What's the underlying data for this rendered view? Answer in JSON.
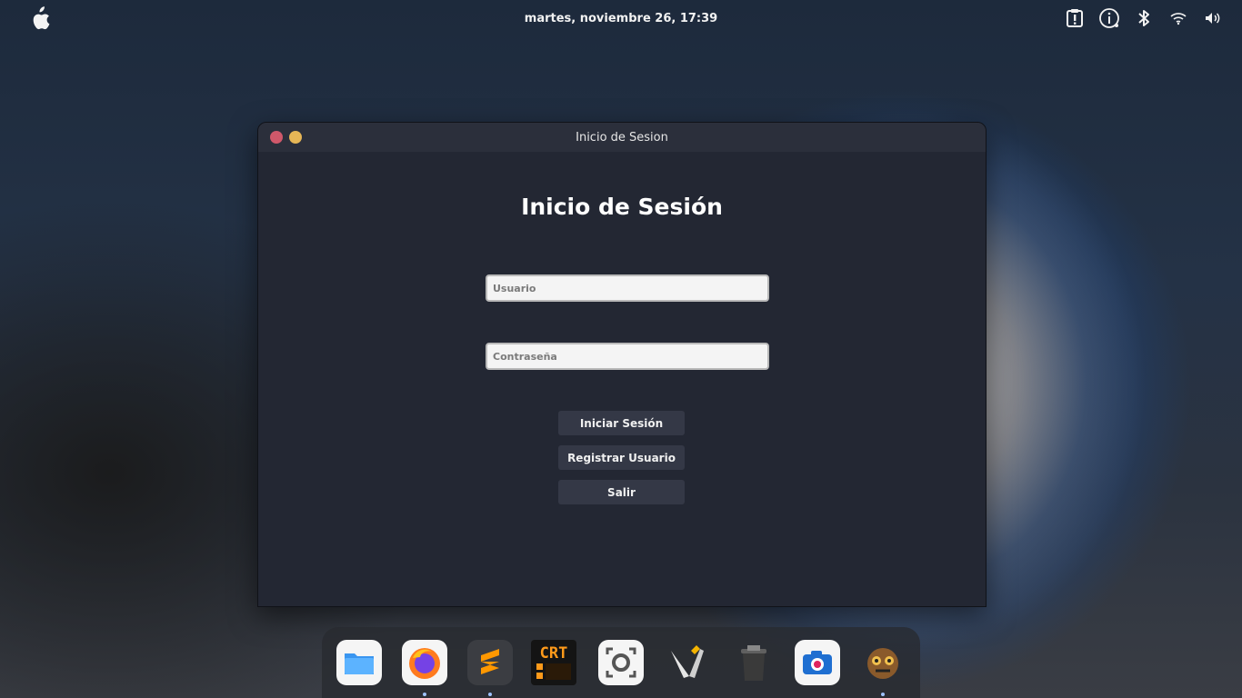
{
  "topbar": {
    "datetime": "martes, noviembre 26, 17:39",
    "tray_icons": [
      "clipboard-icon",
      "info-icon",
      "bluetooth-icon",
      "wifi-icon",
      "volume-icon"
    ]
  },
  "window": {
    "title": "Inicio de Sesion",
    "heading": "Inicio de Sesión",
    "username": {
      "value": "",
      "placeholder": "Usuario"
    },
    "password": {
      "value": "",
      "placeholder": "Contraseña"
    },
    "buttons": {
      "login": "Iniciar Sesión",
      "register": "Registrar Usuario",
      "exit": "Salir"
    }
  },
  "dock": {
    "apps": [
      "files",
      "firefox",
      "sublime-text",
      "cool-retro-term",
      "screenshot",
      "text-editor",
      "trash",
      "camera",
      "game"
    ]
  },
  "colors": {
    "window_bg": "#232733",
    "titlebar_bg": "#2b2f3b",
    "button_bg": "#343846",
    "close_light": "#d0586a",
    "minimize_light": "#e6b656"
  }
}
